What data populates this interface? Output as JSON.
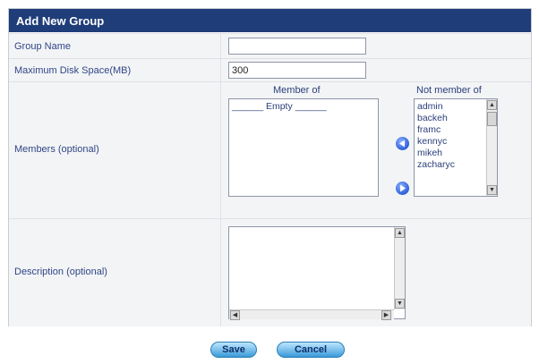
{
  "form": {
    "title": "Add New Group",
    "group_name": {
      "label": "Group Name",
      "value": ""
    },
    "disk_space": {
      "label": "Maximum Disk Space(MB)",
      "value": "300"
    },
    "members": {
      "label": "Members (optional)",
      "member_of_caption": "Member of",
      "member_of_empty": "______ Empty ______",
      "not_member_caption": "Not member of",
      "not_member_items": [
        "admin",
        "backeh",
        "framc",
        "kennyc",
        "mikeh",
        "zacharyc"
      ]
    },
    "description": {
      "label": "Description (optional)",
      "value": ""
    }
  },
  "buttons": {
    "save": "Save",
    "cancel": "Cancel"
  },
  "icons": {
    "add": "left-arrow-icon",
    "remove": "right-arrow-icon"
  },
  "colors": {
    "header": "#1f3d79",
    "label_text": "#2f4686",
    "button": "#3a9bd8"
  }
}
